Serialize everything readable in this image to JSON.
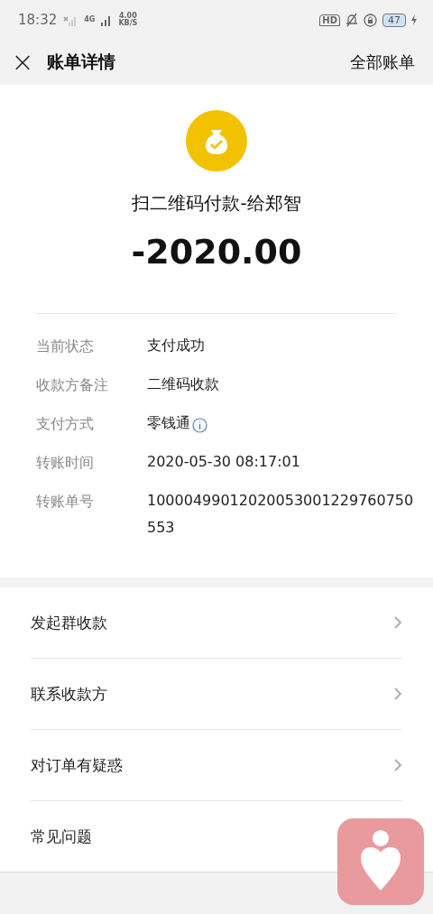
{
  "status_bar": {
    "time": "18:32",
    "network": "4G",
    "speed": "4.00",
    "speed_unit": "KB/S",
    "hd": "HD",
    "battery": "47"
  },
  "header": {
    "close": "×",
    "title": "账单详情",
    "action": "全部账单"
  },
  "summary": {
    "title": "扫二维码付款-给郑智",
    "amount": "-2020.00"
  },
  "details": [
    {
      "label": "当前状态",
      "value": "支付成功",
      "info": false
    },
    {
      "label": "收款方备注",
      "value": "二维码收款",
      "info": false
    },
    {
      "label": "支付方式",
      "value": "零钱通",
      "info": true
    },
    {
      "label": "转账时间",
      "value": "2020-05-30 08:17:01",
      "info": false
    },
    {
      "label": "转账单号",
      "value": "10000499012020053001229760750553",
      "info": false
    }
  ],
  "menu": [
    {
      "label": "发起群收款",
      "chevron": true
    },
    {
      "label": "联系收款方",
      "chevron": true
    },
    {
      "label": "对订单有疑惑",
      "chevron": true
    },
    {
      "label": "常见问题"
    }
  ]
}
